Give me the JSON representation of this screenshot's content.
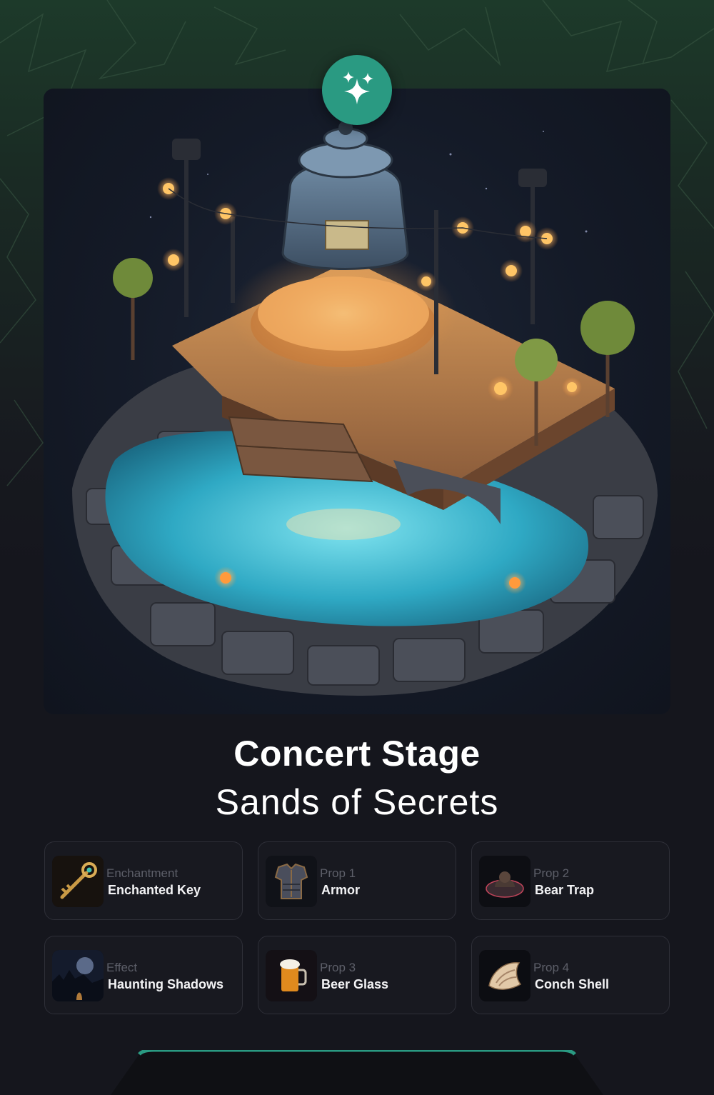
{
  "badge": {
    "icon": "sparkles-icon",
    "color": "#2a9a82"
  },
  "item": {
    "title": "Concert Stage",
    "subtitle": "Sands of Secrets"
  },
  "components": [
    {
      "category": "Enchantment",
      "name": "Enchanted Key",
      "icon": "key-icon"
    },
    {
      "category": "Prop 1",
      "name": "Armor",
      "icon": "armor-icon"
    },
    {
      "category": "Prop 2",
      "name": "Bear Trap",
      "icon": "bear-trap-icon"
    },
    {
      "category": "Effect",
      "name": "Haunting Shadows",
      "icon": "haunting-shadows-icon"
    },
    {
      "category": "Prop 3",
      "name": "Beer Glass",
      "icon": "beer-glass-icon"
    },
    {
      "category": "Prop 4",
      "name": "Conch Shell",
      "icon": "conch-shell-icon"
    }
  ],
  "colors": {
    "accent": "#2a9a82",
    "background": "#15161d",
    "card_border": "#2e2f38"
  }
}
